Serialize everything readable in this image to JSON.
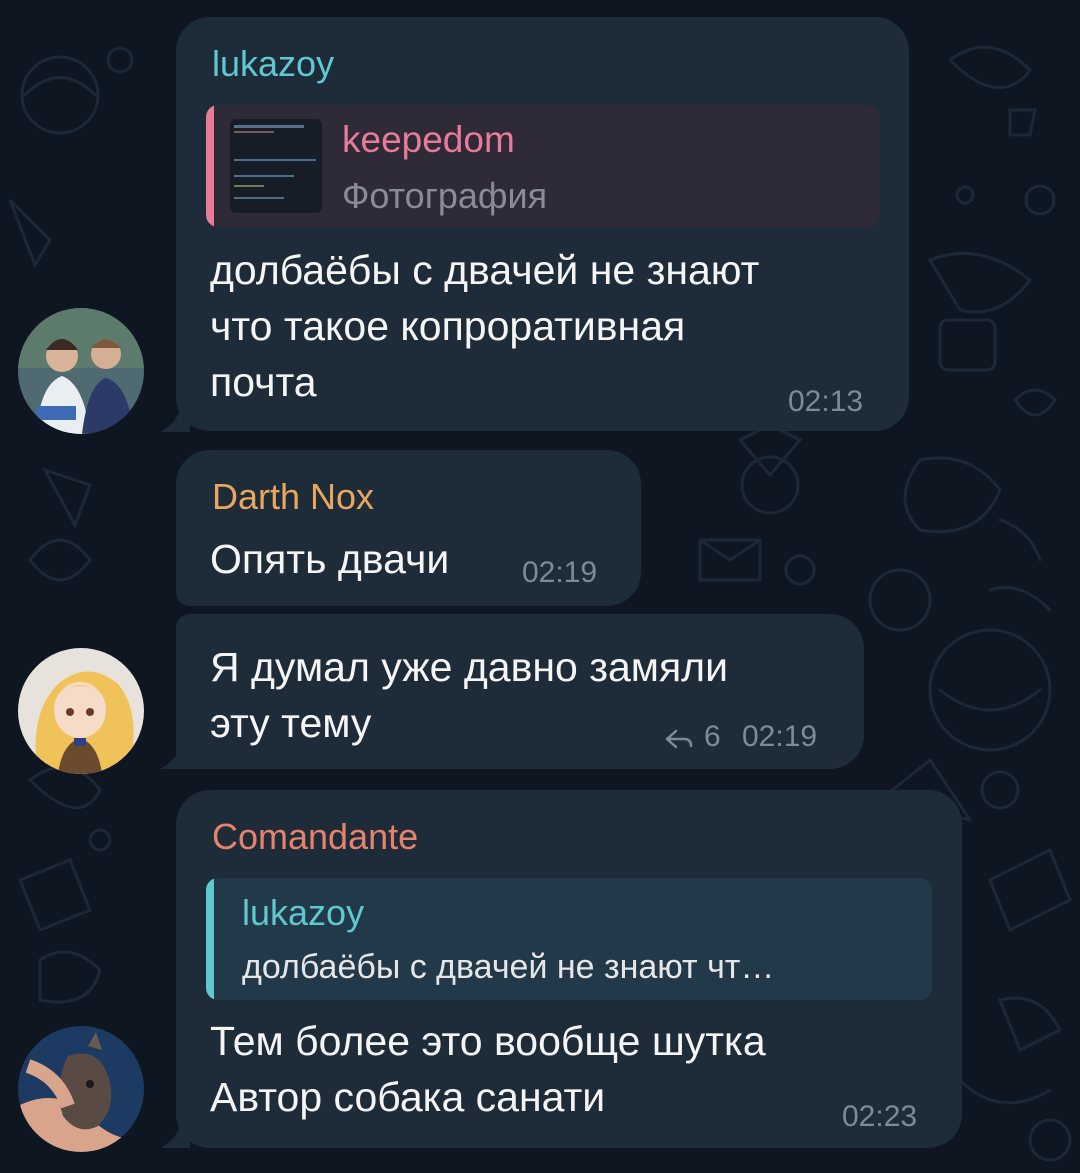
{
  "messages": [
    {
      "sender": "lukazoy",
      "reply": {
        "name": "keepedom",
        "text": "Фотография"
      },
      "lines": [
        "долбаёбы с двачей не знают",
        "что такое копроративная",
        "почта"
      ],
      "time": "02:13"
    },
    {
      "sender": "Darth Nox",
      "lines": [
        "Опять двачи"
      ],
      "time": "02:19"
    },
    {
      "lines": [
        "Я думал уже давно замяли",
        "эту тему"
      ],
      "reply_count": "6",
      "time": "02:19"
    },
    {
      "sender": "Comandante",
      "reply": {
        "name": "lukazoy",
        "text": "долбаёбы с двачей не знают чт…"
      },
      "lines": [
        "Тем более это вообще шутка",
        "Автор собака санати"
      ],
      "time": "02:23"
    }
  ],
  "colors": {
    "background": "#0e1621",
    "bubble": "#1e2c3a",
    "lukazoy": "#5fc9cf",
    "keepedom": "#e87b9a",
    "darth_nox": "#e9a65c",
    "comandante": "#e7826b",
    "reply_pink_bg": "#2e2a37",
    "reply_teal_bg": "#22394a",
    "timestamp": "#7d8b99"
  },
  "icons": [
    "reply-arrow-icon",
    "photo-thumbnail",
    "avatar-lukazoy",
    "avatar-anime-girl",
    "avatar-comandante"
  ]
}
